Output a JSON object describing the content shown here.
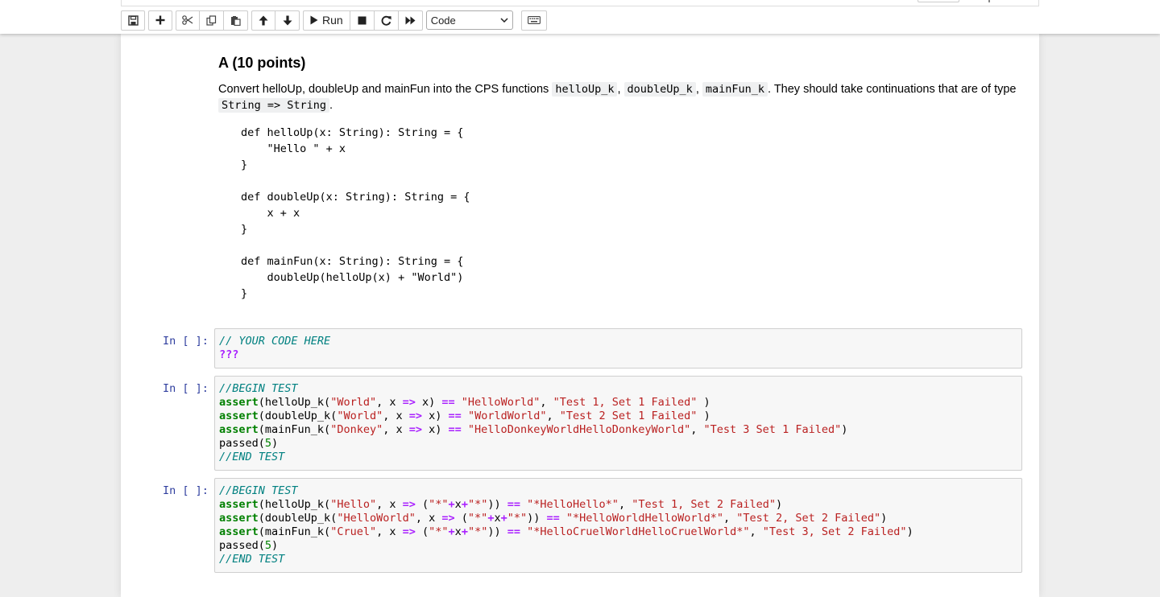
{
  "toolbar": {
    "run_label": "Run",
    "cell_type": "Code",
    "icons": [
      "save-icon",
      "plus-icon",
      "scissors-icon",
      "copy-icon",
      "paste-icon",
      "arrow-up-icon",
      "arrow-down-icon",
      "play-icon",
      "stop-icon",
      "restart-icon",
      "fast-forward-icon",
      "keyboard-icon"
    ]
  },
  "markdown": {
    "title": "A (10 points)",
    "intro_before": "Convert helloUp, doubleUp and mainFun into the CPS functions",
    "fn1": "helloUp_k",
    "fn2": "doubleUp_k",
    "fn3": "mainFun_k",
    "intro_after": ". They should take continuations that are of type",
    "type": "String => String",
    "code_lines": [
      "def helloUp(x: String): String = {",
      "    \"Hello \" + x",
      "}",
      "",
      "def doubleUp(x: String): String = {",
      "    x + x",
      "}",
      "",
      "def mainFun(x: String): String = {",
      "    doubleUp(helloUp(x) + \"World\")",
      "}"
    ]
  },
  "cells": [
    {
      "prompt": "In [ ]:",
      "lines": [
        [
          {
            "t": "// YOUR CODE HERE",
            "c": "cm"
          }
        ],
        [
          {
            "t": "???",
            "c": "op"
          }
        ]
      ]
    },
    {
      "prompt": "In [ ]:",
      "lines": [
        [
          {
            "t": "//BEGIN TEST",
            "c": "cm"
          }
        ],
        [
          {
            "t": "assert",
            "c": "kw"
          },
          {
            "t": "(helloUp_k("
          },
          {
            "t": "\"World\"",
            "c": "st"
          },
          {
            "t": ", x "
          },
          {
            "t": "=>",
            "c": "op"
          },
          {
            "t": " x) "
          },
          {
            "t": "==",
            "c": "op"
          },
          {
            "t": " "
          },
          {
            "t": "\"HelloWorld\"",
            "c": "st"
          },
          {
            "t": ", "
          },
          {
            "t": "\"Test 1, Set 1 Failed\"",
            "c": "st"
          },
          {
            "t": " )"
          }
        ],
        [
          {
            "t": "assert",
            "c": "kw"
          },
          {
            "t": "(doubleUp_k("
          },
          {
            "t": "\"World\"",
            "c": "st"
          },
          {
            "t": ", x "
          },
          {
            "t": "=>",
            "c": "op"
          },
          {
            "t": " x) "
          },
          {
            "t": "==",
            "c": "op"
          },
          {
            "t": " "
          },
          {
            "t": "\"WorldWorld\"",
            "c": "st"
          },
          {
            "t": ", "
          },
          {
            "t": "\"Test 2 Set 1 Failed\"",
            "c": "st"
          },
          {
            "t": " )"
          }
        ],
        [
          {
            "t": "assert",
            "c": "kw"
          },
          {
            "t": "(mainFun_k("
          },
          {
            "t": "\"Donkey\"",
            "c": "st"
          },
          {
            "t": ", x "
          },
          {
            "t": "=>",
            "c": "op"
          },
          {
            "t": " x) "
          },
          {
            "t": "==",
            "c": "op"
          },
          {
            "t": " "
          },
          {
            "t": "\"HelloDonkeyWorldHelloDonkeyWorld\"",
            "c": "st"
          },
          {
            "t": ", "
          },
          {
            "t": "\"Test 3 Set 1 Failed\"",
            "c": "st"
          },
          {
            "t": ")"
          }
        ],
        [
          {
            "t": "passed("
          },
          {
            "t": "5",
            "c": "nm"
          },
          {
            "t": ")"
          }
        ],
        [
          {
            "t": "//END TEST",
            "c": "cm"
          }
        ]
      ]
    },
    {
      "prompt": "In [ ]:",
      "lines": [
        [
          {
            "t": "//BEGIN TEST",
            "c": "cm"
          }
        ],
        [
          {
            "t": "assert",
            "c": "kw"
          },
          {
            "t": "(helloUp_k("
          },
          {
            "t": "\"Hello\"",
            "c": "st"
          },
          {
            "t": ", x "
          },
          {
            "t": "=>",
            "c": "op"
          },
          {
            "t": " ("
          },
          {
            "t": "\"*\"",
            "c": "st"
          },
          {
            "t": "+",
            "c": "op"
          },
          {
            "t": "x"
          },
          {
            "t": "+",
            "c": "op"
          },
          {
            "t": "\"*\"",
            "c": "st"
          },
          {
            "t": ")) "
          },
          {
            "t": "==",
            "c": "op"
          },
          {
            "t": " "
          },
          {
            "t": "\"*HelloHello*\"",
            "c": "st"
          },
          {
            "t": ", "
          },
          {
            "t": "\"Test 1, Set 2 Failed\"",
            "c": "st"
          },
          {
            "t": ")"
          }
        ],
        [
          {
            "t": "assert",
            "c": "kw"
          },
          {
            "t": "(doubleUp_k("
          },
          {
            "t": "\"HelloWorld\"",
            "c": "st"
          },
          {
            "t": ", x "
          },
          {
            "t": "=>",
            "c": "op"
          },
          {
            "t": " ("
          },
          {
            "t": "\"*\"",
            "c": "st"
          },
          {
            "t": "+",
            "c": "op"
          },
          {
            "t": "x"
          },
          {
            "t": "+",
            "c": "op"
          },
          {
            "t": "\"*\"",
            "c": "st"
          },
          {
            "t": ")) "
          },
          {
            "t": "==",
            "c": "op"
          },
          {
            "t": " "
          },
          {
            "t": "\"*HelloWorldHelloWorld*\"",
            "c": "st"
          },
          {
            "t": ", "
          },
          {
            "t": "\"Test 2, Set 2 Failed\"",
            "c": "st"
          },
          {
            "t": ")"
          }
        ],
        [
          {
            "t": "assert",
            "c": "kw"
          },
          {
            "t": "(mainFun_k("
          },
          {
            "t": "\"Cruel\"",
            "c": "st"
          },
          {
            "t": ", x "
          },
          {
            "t": "=>",
            "c": "op"
          },
          {
            "t": " ("
          },
          {
            "t": "\"*\"",
            "c": "st"
          },
          {
            "t": "+",
            "c": "op"
          },
          {
            "t": "x"
          },
          {
            "t": "+",
            "c": "op"
          },
          {
            "t": "\"*\"",
            "c": "st"
          },
          {
            "t": ")) "
          },
          {
            "t": "==",
            "c": "op"
          },
          {
            "t": " "
          },
          {
            "t": "\"*HelloCruelWorldHelloCruelWorld*\"",
            "c": "st"
          },
          {
            "t": ", "
          },
          {
            "t": "\"Test 3, Set 2 Failed\"",
            "c": "st"
          },
          {
            "t": ")"
          }
        ],
        [
          {
            "t": "passed("
          },
          {
            "t": "5",
            "c": "nm"
          },
          {
            "t": ")"
          }
        ],
        [
          {
            "t": "//END TEST",
            "c": "cm"
          }
        ]
      ]
    }
  ]
}
